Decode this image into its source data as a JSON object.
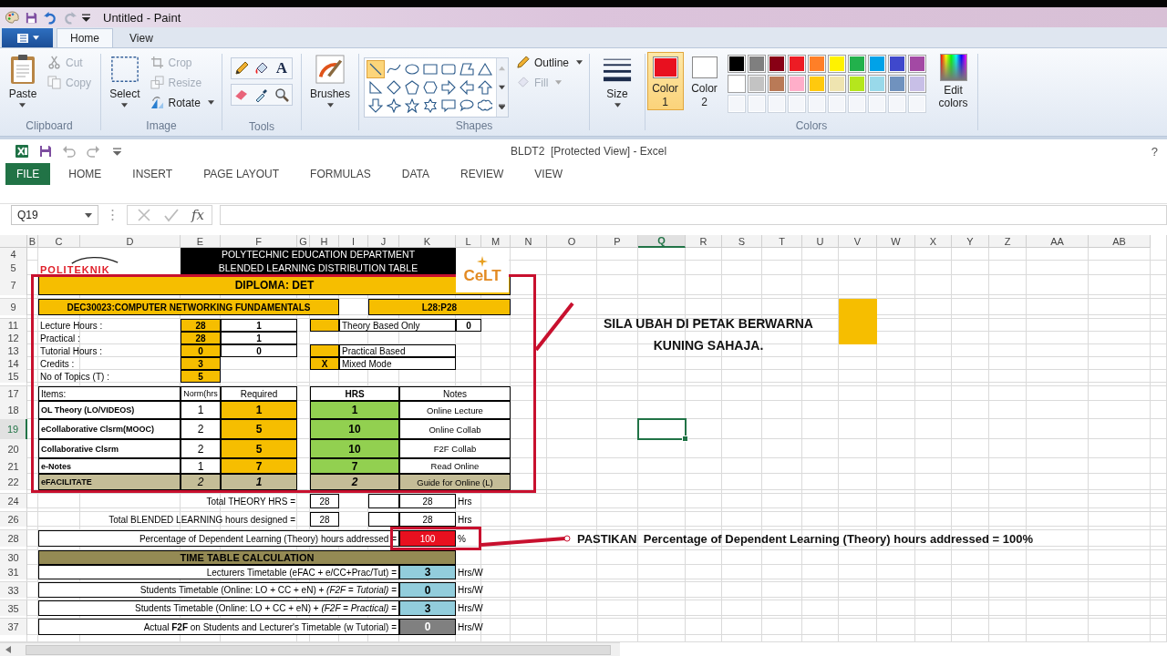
{
  "paint": {
    "title": "Untitled - Paint",
    "tabs": [
      {
        "label": "Home",
        "selected": true
      },
      {
        "label": "View",
        "selected": false
      }
    ],
    "clipboard": {
      "label": "Clipboard",
      "paste": "Paste",
      "actions": [
        {
          "label": "Cut",
          "kind": "cut",
          "disabled": true
        },
        {
          "label": "Copy",
          "kind": "copy",
          "disabled": true
        }
      ]
    },
    "image": {
      "label": "Image",
      "select": "Select",
      "actions": [
        {
          "label": "Crop",
          "kind": "crop",
          "disabled": true
        },
        {
          "label": "Resize",
          "kind": "resize",
          "disabled": true
        },
        {
          "label": "Rotate",
          "kind": "rotate",
          "disabled": false
        }
      ]
    },
    "tools": {
      "label": "Tools",
      "text_glyph": "A"
    },
    "brushes": "Brushes",
    "shapes": {
      "label": "Shapes",
      "outline": "Outline",
      "fill": "Fill",
      "fill_disabled": true,
      "items": [
        {
          "kind": "line",
          "selected": true
        },
        {
          "kind": "curve",
          "selected": false
        },
        {
          "kind": "oval",
          "selected": false
        },
        {
          "kind": "rect",
          "selected": false
        },
        {
          "kind": "roundrect",
          "selected": false
        },
        {
          "kind": "polygon",
          "selected": false
        },
        {
          "kind": "triangle",
          "selected": false
        },
        {
          "kind": "right-triangle",
          "selected": false
        },
        {
          "kind": "diamond",
          "selected": false
        },
        {
          "kind": "pentagon",
          "selected": false
        },
        {
          "kind": "hexagon",
          "selected": false
        },
        {
          "kind": "arrow-right",
          "selected": false
        },
        {
          "kind": "arrow-left",
          "selected": false
        },
        {
          "kind": "arrow-up",
          "selected": false
        },
        {
          "kind": "arrow-down",
          "selected": false
        },
        {
          "kind": "star4",
          "selected": false
        },
        {
          "kind": "star5",
          "selected": false
        },
        {
          "kind": "star6",
          "selected": false
        },
        {
          "kind": "callout-rect",
          "selected": false
        },
        {
          "kind": "callout-oval",
          "selected": false
        },
        {
          "kind": "callout-cloud",
          "selected": false
        }
      ]
    },
    "size": "Size",
    "colors": {
      "label": "Colors",
      "edit": "Edit colors",
      "active": [
        {
          "label": "Color 1",
          "color": "#e8101f",
          "selected": true
        },
        {
          "label": "Color 2",
          "color": "#ffffff",
          "selected": false
        }
      ],
      "palette": [
        {
          "color": "#000000"
        },
        {
          "color": "#7f7f7f"
        },
        {
          "color": "#880015"
        },
        {
          "color": "#ed1c24"
        },
        {
          "color": "#ff7f27"
        },
        {
          "color": "#fff200"
        },
        {
          "color": "#22b14c"
        },
        {
          "color": "#00a2e8"
        },
        {
          "color": "#3f48cc"
        },
        {
          "color": "#a349a4"
        },
        {
          "color": "#ffffff"
        },
        {
          "color": "#c3c3c3"
        },
        {
          "color": "#b97a57"
        },
        {
          "color": "#ffaec9"
        },
        {
          "color": "#ffc90e"
        },
        {
          "color": "#efe4b0"
        },
        {
          "color": "#b5e61d"
        },
        {
          "color": "#99d9ea"
        },
        {
          "color": "#7092be"
        },
        {
          "color": "#c8bfe7"
        }
      ]
    }
  },
  "excel": {
    "title": "BLDT2  [Protected View] - Excel",
    "help": "?",
    "name_box": "Q19",
    "fx": "fx",
    "tabs": [
      {
        "label": "FILE",
        "kind": "file",
        "selected": false
      },
      {
        "label": "HOME",
        "kind": "tab",
        "selected": false
      },
      {
        "label": "INSERT",
        "kind": "tab",
        "selected": false
      },
      {
        "label": "PAGE LAYOUT",
        "kind": "tab",
        "selected": false
      },
      {
        "label": "FORMULAS",
        "kind": "tab",
        "selected": false
      },
      {
        "label": "DATA",
        "kind": "tab",
        "selected": false
      },
      {
        "label": "REVIEW",
        "kind": "tab",
        "selected": false
      },
      {
        "label": "VIEW",
        "kind": "tab",
        "selected": false
      }
    ]
  },
  "sheet": {
    "columns": [
      {
        "label": "B",
        "selected": false
      },
      {
        "label": "C",
        "selected": false
      },
      {
        "label": "D",
        "selected": false
      },
      {
        "label": "E",
        "selected": false
      },
      {
        "label": "F",
        "selected": false
      },
      {
        "label": "G",
        "selected": false
      },
      {
        "label": "H",
        "selected": false
      },
      {
        "label": "I",
        "selected": false
      },
      {
        "label": "J",
        "selected": false
      },
      {
        "label": "K",
        "selected": false
      },
      {
        "label": "L",
        "selected": false
      },
      {
        "label": "M",
        "selected": false
      },
      {
        "label": "N",
        "selected": false
      },
      {
        "label": "O",
        "selected": false
      },
      {
        "label": "P",
        "selected": false
      },
      {
        "label": "Q",
        "selected": true
      },
      {
        "label": "R",
        "selected": false
      },
      {
        "label": "S",
        "selected": false
      },
      {
        "label": "T",
        "selected": false
      },
      {
        "label": "U",
        "selected": false
      },
      {
        "label": "V",
        "selected": false
      },
      {
        "label": "W",
        "selected": false
      },
      {
        "label": "X",
        "selected": false
      },
      {
        "label": "Y",
        "selected": false
      },
      {
        "label": "Z",
        "selected": false
      },
      {
        "label": "AA",
        "selected": false
      },
      {
        "label": "AB",
        "selected": false
      }
    ],
    "rows": [
      {
        "label": "4",
        "selected": false
      },
      {
        "label": "5",
        "selected": false
      },
      {
        "label": "7",
        "selected": false
      },
      {
        "label": "9",
        "selected": false
      },
      {
        "label": "11",
        "selected": false
      },
      {
        "label": "12",
        "selected": false
      },
      {
        "label": "13",
        "selected": false
      },
      {
        "label": "14",
        "selected": false
      },
      {
        "label": "15",
        "selected": false
      },
      {
        "label": "17",
        "selected": false
      },
      {
        "label": "18",
        "selected": false
      },
      {
        "label": "19",
        "selected": true
      },
      {
        "label": "20",
        "selected": false
      },
      {
        "label": "21",
        "selected": false
      },
      {
        "label": "22",
        "selected": false
      },
      {
        "label": "24",
        "selected": false
      },
      {
        "label": "26",
        "selected": false
      },
      {
        "label": "28",
        "selected": false
      },
      {
        "label": "30",
        "selected": false
      },
      {
        "label": "31",
        "selected": false
      },
      {
        "label": "33",
        "selected": false
      },
      {
        "label": "35",
        "selected": false
      },
      {
        "label": "37",
        "selected": false
      }
    ],
    "logo": "POLITEKNIK",
    "banner": [
      "POLYTECHNIC EDUCATION DEPARTMENT",
      "BLENDED LEARNING DISTRIBUTION TABLE"
    ],
    "centre_logo": "CeLT",
    "diploma": "DIPLOMA: DET",
    "course": "DEC30023:COMPUTER NETWORKING FUNDAMENTALS",
    "ratio": "L28:P28",
    "hours": [
      {
        "label": "Lecture Hours :",
        "value": "28",
        "factor": "1"
      },
      {
        "label": "Practical :",
        "value": "28",
        "factor": "1"
      },
      {
        "label": "Tutorial Hours :",
        "value": "0",
        "factor": "0"
      },
      {
        "label": "Credits :",
        "value": "3"
      },
      {
        "label": "No of Topics (T) :",
        "value": "5"
      }
    ],
    "modes": [
      {
        "label": "Theory Based Only",
        "value": "0"
      },
      {
        "label": "Practical Based"
      },
      {
        "label": "Mixed Mode",
        "mark": "X"
      }
    ],
    "items_table": {
      "columns": [
        "Items:",
        "Norm(hrs",
        "Required",
        "HRS",
        "Notes"
      ],
      "rows": [
        {
          "item": "OL Theory (LO/VIDEOS)",
          "norm": "1",
          "required": "1",
          "hrs": "1",
          "notes": "Online Lecture",
          "kind": "activity"
        },
        {
          "item": "eCollaborative Clsrm(MOOC)",
          "norm": "2",
          "required": "5",
          "hrs": "10",
          "notes": "Online Collab",
          "kind": "activity"
        },
        {
          "item": "Collaborative Clsrm",
          "norm": "2",
          "required": "5",
          "hrs": "10",
          "notes": "F2F Collab",
          "kind": "activity"
        },
        {
          "item": "e-Notes",
          "norm": "1",
          "required": "7",
          "hrs": "7",
          "notes": "Read Online",
          "kind": "activity"
        },
        {
          "item": "eFACILITATE",
          "norm": "2",
          "required": "1",
          "hrs": "2",
          "notes": "Guide for Online (L)",
          "kind": "facilitate"
        }
      ]
    },
    "totals": [
      {
        "label": "Total THEORY HRS =",
        "designed": "28",
        "total": "28",
        "unit": "Hrs"
      },
      {
        "label": "Total BLENDED LEARNING hours designed =",
        "designed": "28",
        "total": "28",
        "unit": "Hrs"
      }
    ],
    "percentage": {
      "label": "Percentage of Dependent Learning (Theory) hours addressed =",
      "value": "100",
      "unit": "%"
    },
    "timetable": {
      "title": "TIME TABLE CALCULATION",
      "rows": [
        {
          "label": "Lecturers Timetable (eFAC + e/CC+Prac/Tut) =",
          "value": "3",
          "unit": "Hrs/W",
          "kind": "planned"
        },
        {
          "label": "Students Timetable (Online: LO + CC + eN) + *(F2F = Tutorial)*  =",
          "value": "0",
          "unit": "Hrs/W",
          "kind": "planned"
        },
        {
          "label": "Students Timetable (Online: LO + CC + eN) + *(F2F = Practical)*  =",
          "value": "3",
          "unit": "Hrs/W",
          "kind": "planned"
        },
        {
          "label": "Actual **F2F**  on Students and Lecturer's Timetable (w Tutorial) =",
          "value": "0",
          "unit": "Hrs/W",
          "kind": "actual"
        }
      ]
    },
    "notes": [
      "SILA UBAH DI PETAK BERWARNA KUNING SAHAJA.",
      "PASTIKAN  Percentage of Dependent Learning (Theory) hours addressed = 100%"
    ]
  }
}
